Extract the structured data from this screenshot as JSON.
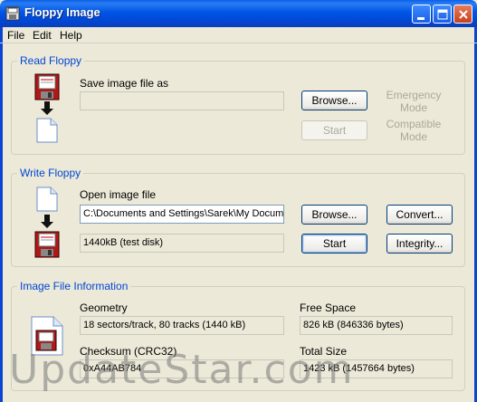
{
  "window": {
    "title": "Floppy Image"
  },
  "menu": [
    "File",
    "Edit",
    "Help"
  ],
  "read_floppy": {
    "title": "Read Floppy",
    "save_label": "Save image file as",
    "save_value": "",
    "browse_label": "Browse...",
    "start_label": "Start",
    "emergency_mode": "Emergency\nMode",
    "compatible_mode": "Compatible\nMode"
  },
  "write_floppy": {
    "title": "Write Floppy",
    "open_label": "Open image file",
    "open_value": "C:\\Documents and Settings\\Sarek\\My Documents",
    "browse_label": "Browse...",
    "convert_label": "Convert...",
    "disk_value": "1440kB (test disk)",
    "start_label": "Start",
    "integrity_label": "Integrity..."
  },
  "image_info": {
    "title": "Image File Information",
    "geometry_label": "Geometry",
    "geometry_value": "18 sectors/track, 80 tracks (1440 kB)",
    "free_space_label": "Free Space",
    "free_space_value": "826 kB (846336 bytes)",
    "checksum_label": "Checksum (CRC32)",
    "checksum_value": "0xA44AB784",
    "total_size_label": "Total Size",
    "total_size_value": "1423 kB (1457664 bytes)"
  },
  "watermark": "UpdateStar.com",
  "icons": {
    "app": "floppy-app-icon",
    "floppy": "floppy-disk-icon",
    "file": "document-icon",
    "arrow": "arrow-down-icon"
  }
}
